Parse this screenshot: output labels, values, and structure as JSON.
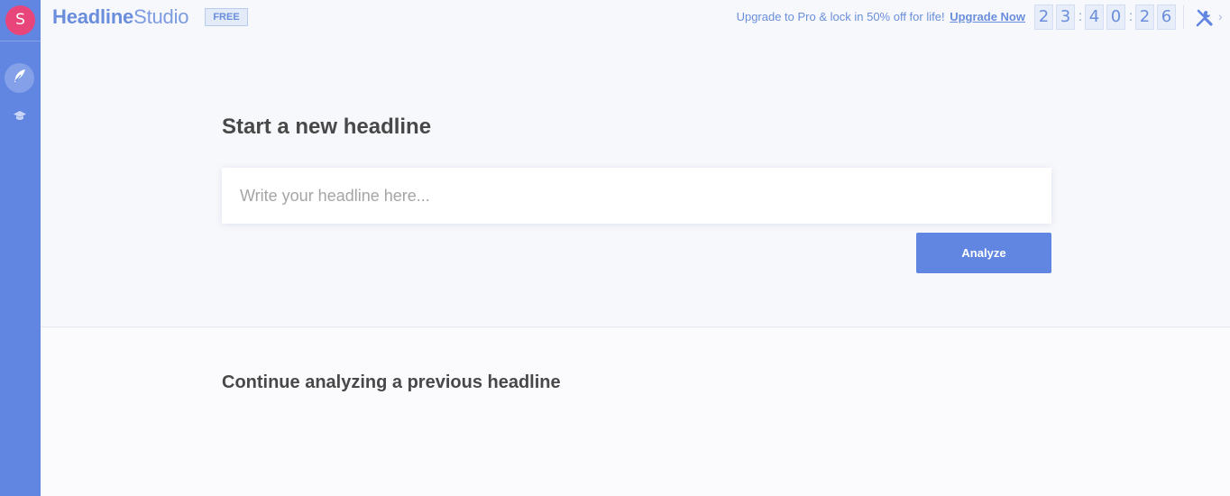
{
  "user": {
    "avatar_initial": "S"
  },
  "header": {
    "logo_bold": "Headline",
    "logo_light": "Studio",
    "plan_badge": "FREE",
    "promo_text": "Upgrade to Pro & lock in 50% off for life!",
    "promo_link": "Upgrade Now",
    "countdown": [
      "2",
      "3",
      "4",
      "0",
      "2",
      "6"
    ]
  },
  "sidebar": {
    "items": [
      {
        "icon": "feather-icon",
        "active": true
      },
      {
        "icon": "graduation-cap-icon",
        "active": false
      }
    ]
  },
  "main": {
    "title": "Start a new headline",
    "input": {
      "placeholder": "Write your headline here...",
      "value": ""
    },
    "analyze_label": "Analyze"
  },
  "previous": {
    "title": "Continue analyzing a previous headline"
  },
  "colors": {
    "accent": "#6186e2",
    "avatar": "#e8457a",
    "text_dark": "#484848"
  }
}
